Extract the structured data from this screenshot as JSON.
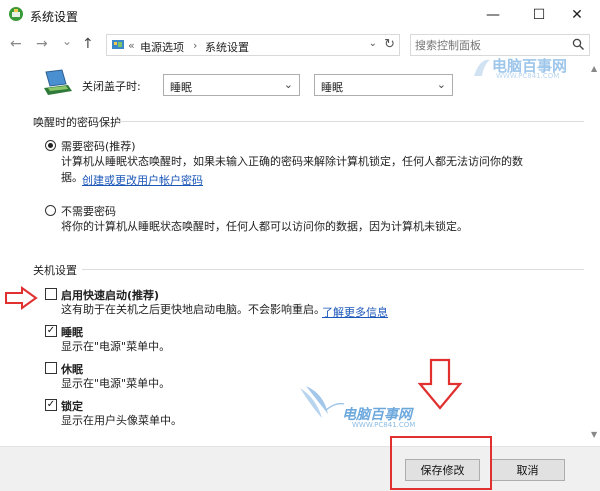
{
  "window": {
    "title": "系统设置",
    "controls": {
      "minimize": "—",
      "maximize": "☐",
      "close": "✕"
    }
  },
  "nav": {
    "back": "←",
    "forward": "→",
    "recent": "⌄",
    "up": "↑",
    "breadcrumb_sep": "«",
    "breadcrumb": [
      "电源选项",
      "系统设置"
    ],
    "crumb_arrow": "›",
    "dropdown": "⌄",
    "refresh": "↻",
    "search_placeholder": "搜索控制面板"
  },
  "lid": {
    "label": "关闭盖子时:",
    "battery_value": "睡眠",
    "plugged_value": "睡眠"
  },
  "password": {
    "section_title": "唤醒时的密码保护",
    "require": {
      "label": "需要密码(推荐)",
      "desc_line1": "计算机从睡眠状态唤醒时，如果未输入正确的密码来解除计算机锁定，任何人都无法访问你的数",
      "desc_line2": "据。",
      "link": "创建或更改用户帐户密码",
      "checked": true
    },
    "none": {
      "label": "不需要密码",
      "desc": "将你的计算机从睡眠状态唤醒时，任何人都可以访问你的数据，因为计算机未锁定。",
      "checked": false
    }
  },
  "shutdown": {
    "section_title": "关机设置",
    "fast_startup": {
      "label": "启用快速启动(推荐)",
      "desc": "这有助于在关机之后更快地启动电脑。不会影响重启。",
      "link": "了解更多信息",
      "checked": false
    },
    "sleep": {
      "label": "睡眠",
      "desc": "显示在\"电源\"菜单中。",
      "checked": true
    },
    "hibernate": {
      "label": "休眠",
      "desc": "显示在\"电源\"菜单中。",
      "checked": false
    },
    "lock": {
      "label": "锁定",
      "desc": "显示在用户头像菜单中。",
      "checked": true
    }
  },
  "footer": {
    "save": "保存修改",
    "cancel": "取消"
  },
  "watermark": {
    "top_text": "电脑百事网",
    "top_sub": "WWW.PC841.COM",
    "mid_text": "电脑百事网",
    "mid_sub": "WWW.PC841.COM"
  },
  "colors": {
    "link": "#1a56b8",
    "annotation": "#e03030",
    "watermark": "#6ea9de"
  }
}
